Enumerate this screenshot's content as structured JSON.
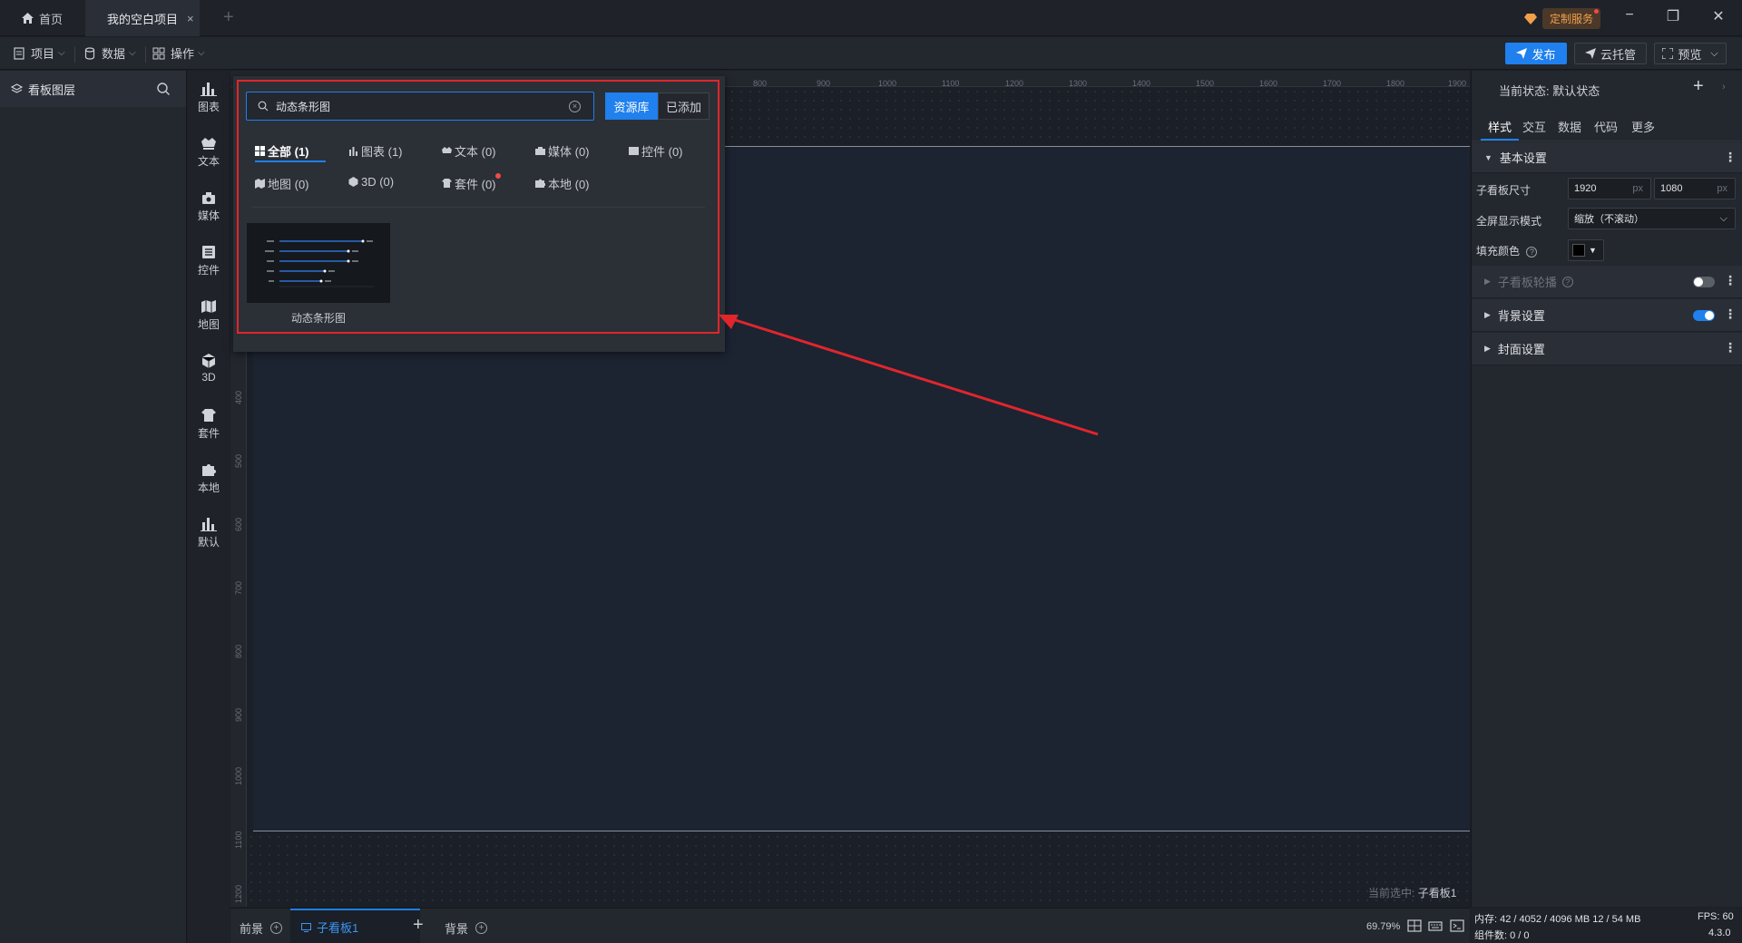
{
  "titlebar": {
    "tabs": [
      {
        "label": "首页",
        "icon": "home-icon"
      },
      {
        "label": "我的空白项目",
        "icon": ""
      }
    ],
    "close_glyph": "×",
    "add_glyph": "+",
    "custom_service": "定制服务",
    "window": {
      "minimize": "−",
      "restore": "❐",
      "close": "✕"
    }
  },
  "menubar": {
    "items": [
      {
        "label": "项目",
        "icon": "document-icon"
      },
      {
        "label": "数据",
        "icon": "database-icon"
      },
      {
        "label": "操作",
        "icon": "grid-icon"
      }
    ],
    "publish": "发布",
    "cloud": "云托管",
    "preview": "预览"
  },
  "layers": {
    "title": "看板图层"
  },
  "compbar": {
    "items": [
      {
        "label": "图表",
        "icon": "bar-chart-icon"
      },
      {
        "label": "文本",
        "icon": "text-icon"
      },
      {
        "label": "媒体",
        "icon": "media-icon"
      },
      {
        "label": "控件",
        "icon": "control-icon"
      },
      {
        "label": "地图",
        "icon": "map-icon"
      },
      {
        "label": "3D",
        "icon": "cube-icon"
      },
      {
        "label": "套件",
        "icon": "kit-icon"
      },
      {
        "label": "本地",
        "icon": "puzzle-icon"
      },
      {
        "label": "默认",
        "icon": "default-chart-icon"
      }
    ]
  },
  "popup": {
    "search_value": "动态条形图",
    "tab_library": "资源库",
    "tab_added": "已添加",
    "categories": [
      {
        "label": "全部 (1)"
      },
      {
        "label": "图表 (1)"
      },
      {
        "label": "文本 (0)"
      },
      {
        "label": "媒体 (0)"
      },
      {
        "label": "控件 (0)"
      },
      {
        "label": "地图 (0)"
      },
      {
        "label": "3D (0)"
      },
      {
        "label": "套件 (0)"
      },
      {
        "label": "本地 (0)"
      }
    ],
    "result_label": "动态条形图"
  },
  "ruler": {
    "top": [
      "800",
      "900",
      "1000",
      "1100",
      "1200",
      "1300",
      "1400",
      "1500",
      "1600",
      "1700",
      "1800",
      "1900"
    ],
    "left": [
      "400",
      "500",
      "600",
      "700",
      "800",
      "900",
      "1000",
      "1100",
      "1200"
    ]
  },
  "canvas": {
    "current_prefix": "当前选中:",
    "current_value": "子看板1"
  },
  "bottombar": {
    "foreground": "前景",
    "board": "子看板1",
    "add": "+",
    "background": "背景",
    "zoom": "69.79%"
  },
  "status": {
    "memory": "内存:  42 / 4052 / 4096 MB  12 / 54 MB",
    "fps": "FPS:  60",
    "components": "组件数: 0 / 0",
    "version": "4.3.0"
  },
  "props": {
    "state": "当前状态:  默认状态",
    "tabs": [
      "样式",
      "交互",
      "数据",
      "代码",
      "更多"
    ],
    "sections": {
      "basic": "基本设置",
      "carousel": "子看板轮播",
      "background": "背景设置",
      "cover": "封面设置"
    },
    "size_label": "子看板尺寸",
    "width": "1920",
    "height": "1080",
    "unit": "px",
    "fullscreen_label": "全屏显示模式",
    "fullscreen_value": "缩放（不滚动）",
    "fill_label": "填充颜色",
    "fill_color": "#000000",
    "toggle_on_color": "#1f80ee"
  }
}
